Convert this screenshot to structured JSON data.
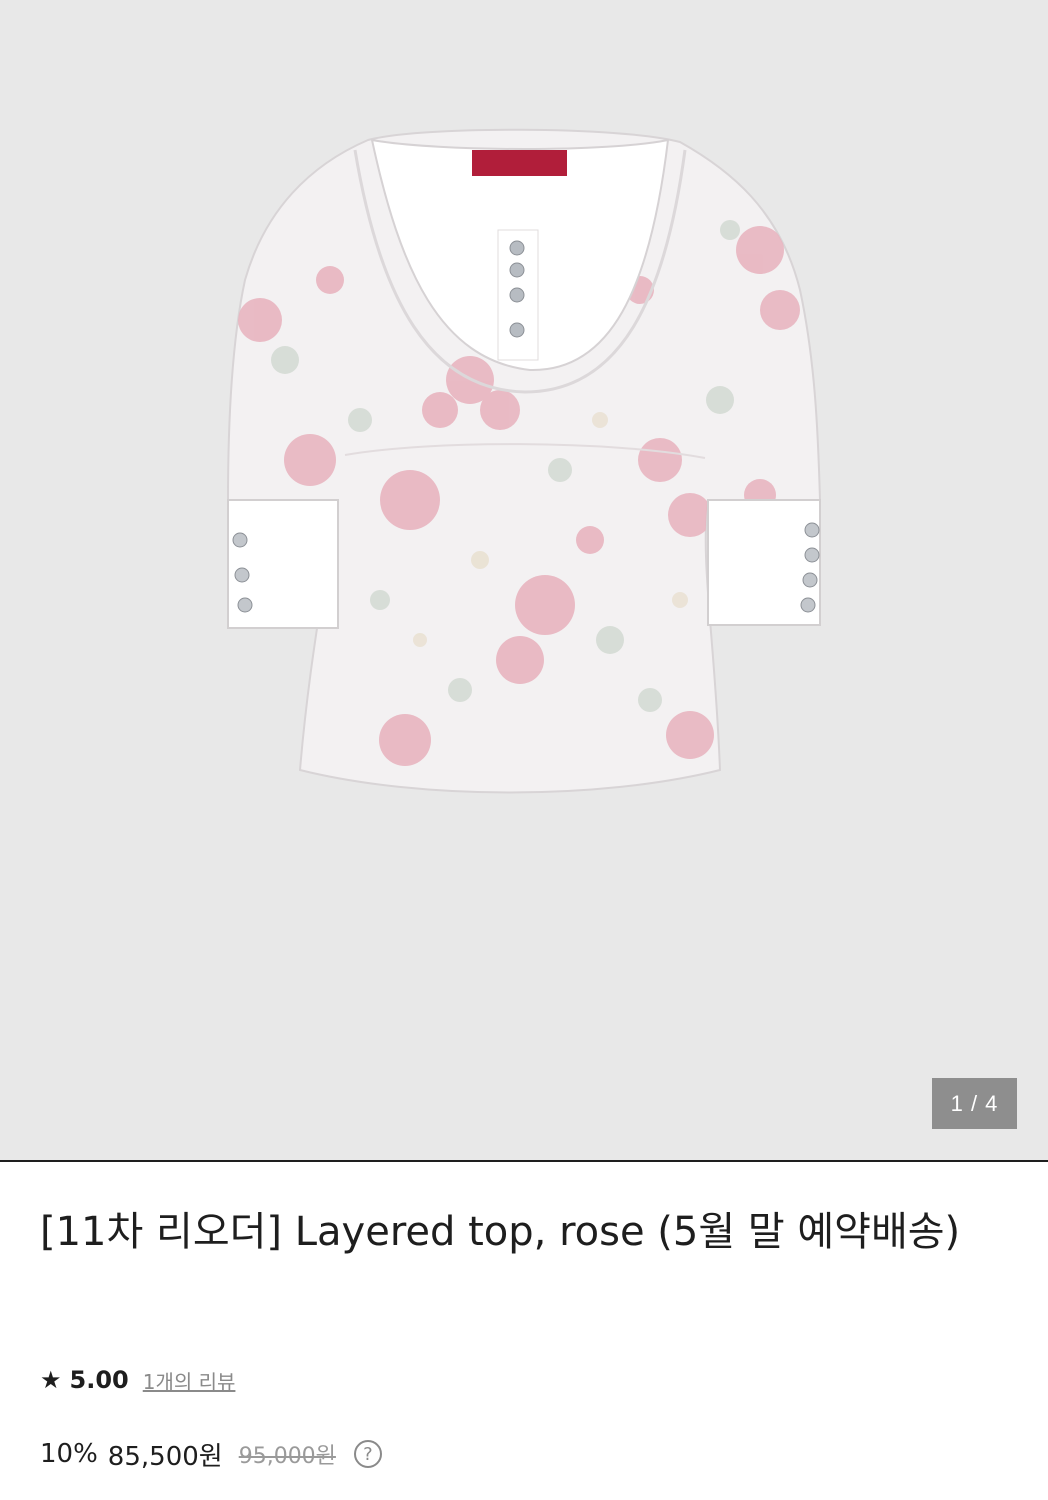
{
  "gallery": {
    "counter": "1 / 4",
    "image_alt": "Layered top, rose"
  },
  "product": {
    "title": "[11차 리오더] Layered top, rose (5월 말 예약배송)",
    "rating": {
      "star": "★",
      "score": "5.00",
      "reviews_link": "1개의 리뷰"
    },
    "price": {
      "discount": "10%",
      "sale": "85,500원",
      "original": "95,000원",
      "help_icon": "question-circle-icon",
      "help_glyph": "?"
    }
  }
}
